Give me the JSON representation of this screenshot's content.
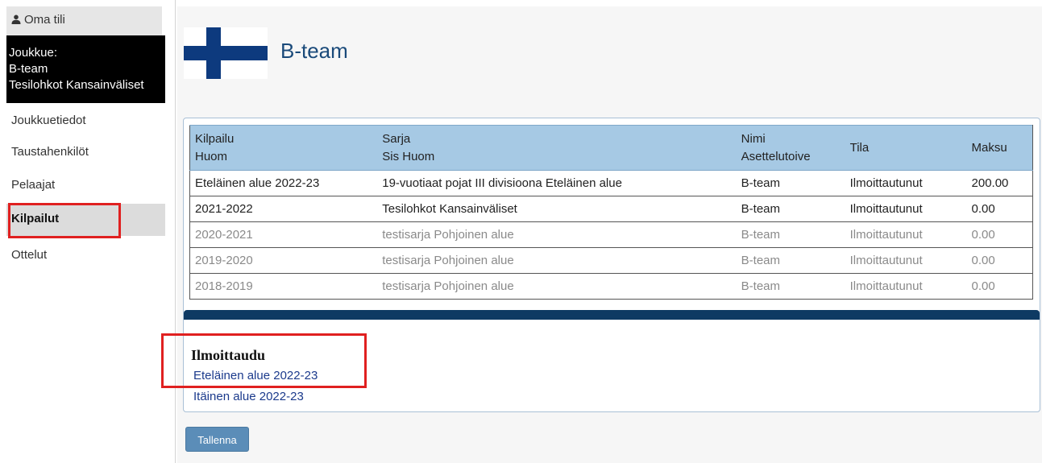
{
  "sidebar": {
    "account_label": "Oma tili",
    "team_box": {
      "line1": "Joukkue:",
      "line2": "B-team",
      "line3": "Tesilohkot Kansainväliset"
    },
    "items": [
      {
        "label": "Joukkuetiedot"
      },
      {
        "label": "Taustahenkilöt"
      },
      {
        "label": "Pelaajat"
      },
      {
        "label": "Kilpailut"
      },
      {
        "label": "Ottelut"
      }
    ]
  },
  "header": {
    "team_name": "B-team"
  },
  "table": {
    "headers": {
      "kilpailu": "Kilpailu",
      "huom": "Huom",
      "sarja": "Sarja",
      "sis_huom": "Sis Huom",
      "nimi": "Nimi",
      "asettelutoive": "Asettelutoive",
      "tila": "Tila",
      "maksu": "Maksu"
    },
    "rows": [
      {
        "kilpailu": "Eteläinen alue 2022-23",
        "sarja": "19-vuotiaat pojat III divisioona Eteläinen alue",
        "nimi": "B-team",
        "tila": "Ilmoittautunut",
        "maksu": "200.00"
      },
      {
        "kilpailu": "2021-2022",
        "sarja": "Tesilohkot Kansainväliset",
        "nimi": "B-team",
        "tila": "Ilmoittautunut",
        "maksu": "0.00"
      },
      {
        "kilpailu": "2020-2021",
        "sarja": "testisarja Pohjoinen alue",
        "nimi": "B-team",
        "tila": "Ilmoittautunut",
        "maksu": "0.00"
      },
      {
        "kilpailu": "2019-2020",
        "sarja": "testisarja Pohjoinen alue",
        "nimi": "B-team",
        "tila": "Ilmoittautunut",
        "maksu": "0.00"
      },
      {
        "kilpailu": "2018-2019",
        "sarja": "testisarja Pohjoinen alue",
        "nimi": "B-team",
        "tila": "Ilmoittautunut",
        "maksu": "0.00"
      }
    ]
  },
  "register": {
    "heading": "Ilmoittaudu",
    "links": [
      {
        "label": "Eteläinen alue 2022-23"
      },
      {
        "label": "Itäinen alue 2022-23"
      }
    ]
  },
  "save_button": "Tallenna",
  "colors": {
    "table_header": "#a6c9e4",
    "dark_bar": "#0e3a63",
    "highlight_box": "#e02020",
    "flag_cross": "#0d3a7e",
    "button": "#5b8db8"
  },
  "icons": {
    "account": "person-icon",
    "flag": "finland-flag-icon"
  }
}
